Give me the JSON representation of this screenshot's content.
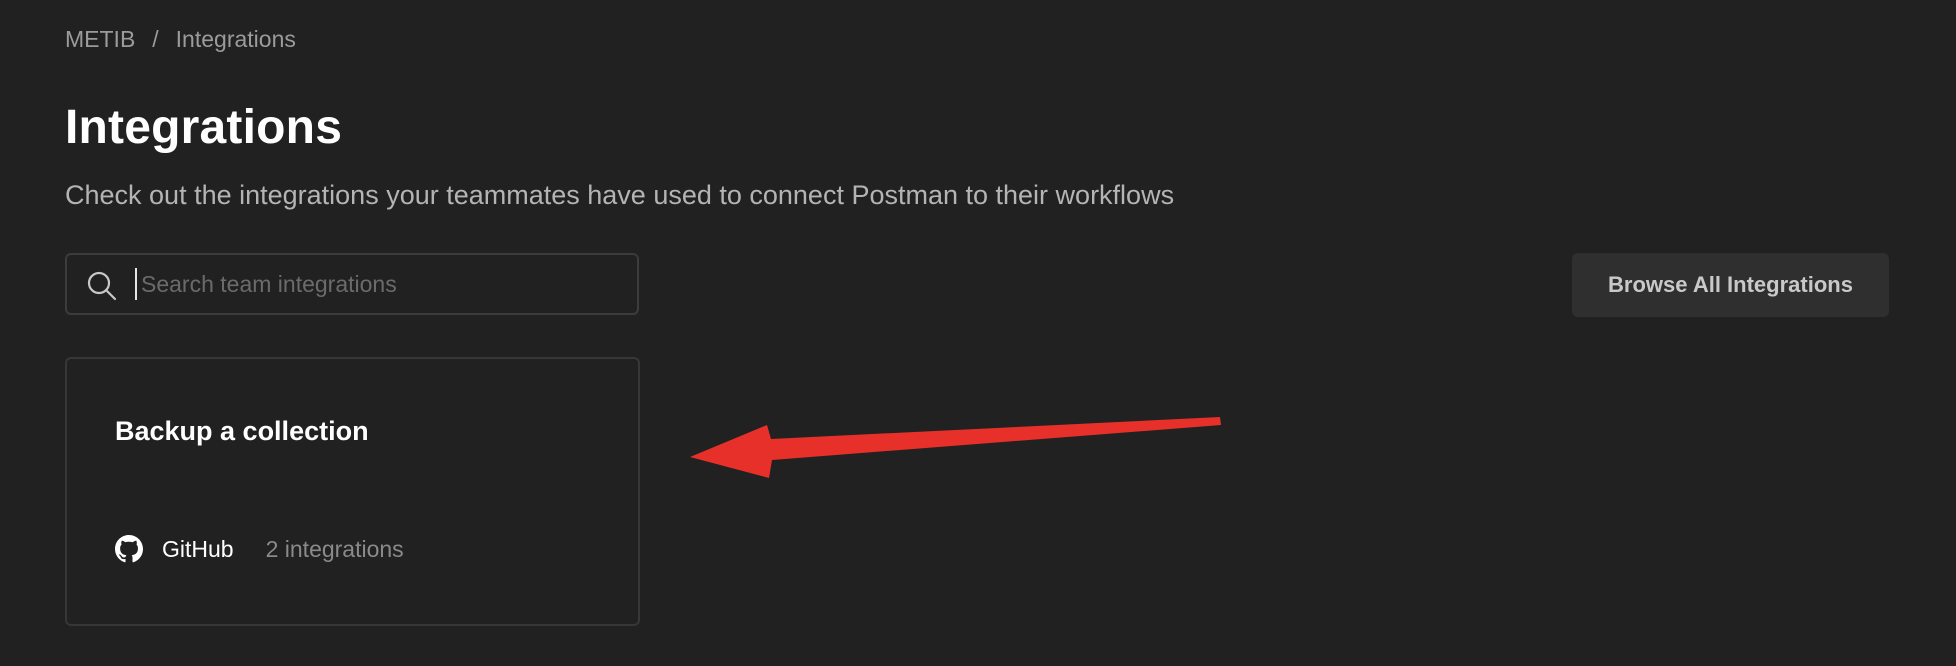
{
  "breadcrumb": {
    "workspace": "METIB",
    "separator": "/",
    "current": "Integrations"
  },
  "header": {
    "title": "Integrations",
    "subtitle": "Check out the integrations your teammates have used to connect Postman to their workflows"
  },
  "search": {
    "placeholder": "Search team integrations",
    "value": "",
    "icon": "search-icon"
  },
  "toolbar": {
    "browse_label": "Browse All Integrations"
  },
  "cards": [
    {
      "title": "Backup a collection",
      "service": "GitHub",
      "service_icon": "github-icon",
      "count_label": "2 integrations"
    }
  ],
  "annotation": {
    "type": "arrow",
    "color": "#e8302a",
    "points_to": "integration-card"
  },
  "colors": {
    "background": "#212121",
    "card_border": "#373737",
    "button_bg": "#2f2f2f",
    "arrow": "#e8302a"
  }
}
